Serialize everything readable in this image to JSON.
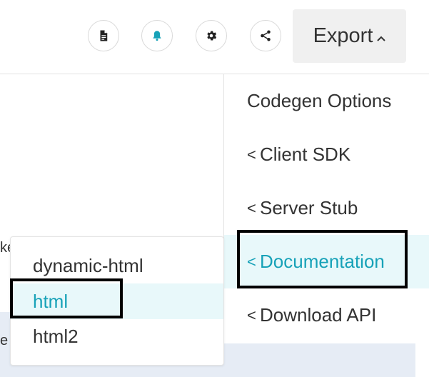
{
  "toolbar": {
    "icons": [
      "document-icon",
      "bell-icon",
      "gear-icon",
      "share-icon"
    ],
    "export_label": "Export",
    "export_caret": "⌃"
  },
  "background": {
    "clipped_text_1": "ke",
    "clipped_text_2": "e '"
  },
  "export_menu": {
    "header": "Codegen Options",
    "items": [
      {
        "label": "Client SDK",
        "chevron": "<"
      },
      {
        "label": "Server Stub",
        "chevron": "<"
      },
      {
        "label": "Documentation",
        "chevron": "<",
        "active": true
      },
      {
        "label": "Download API",
        "chevron": "<"
      }
    ]
  },
  "documentation_submenu": {
    "items": [
      {
        "label": "dynamic-html"
      },
      {
        "label": "html",
        "active": true
      },
      {
        "label": "html2"
      }
    ]
  },
  "colors": {
    "accent": "#17a2b8",
    "active_bg": "#e8f8fa",
    "bell": "#17a2b8",
    "page_strip": "#e6ecf5"
  }
}
